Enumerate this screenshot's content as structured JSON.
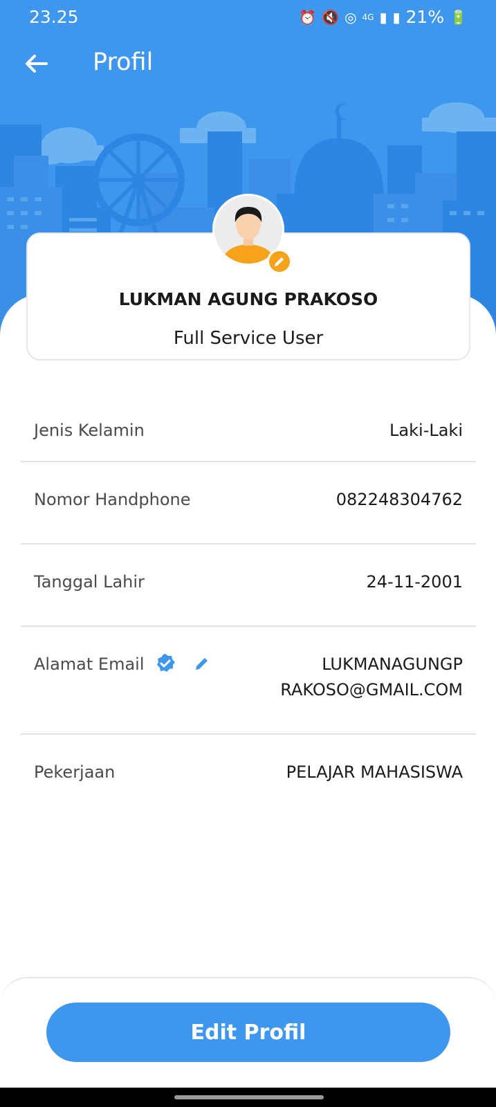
{
  "status_bar": {
    "time": "23.25",
    "network": "4G",
    "battery": "21%"
  },
  "header": {
    "title": "Profil",
    "back_icon": "arrow-left-icon"
  },
  "profile": {
    "name": "LUKMAN AGUNG PRAKOSO",
    "role": "Full Service User",
    "avatar_icon": "user-avatar",
    "edit_icon": "pencil-icon"
  },
  "fields": [
    {
      "label": "Jenis Kelamin",
      "value": "Laki-Laki"
    },
    {
      "label": "Nomor Handphone",
      "value": "082248304762"
    },
    {
      "label": "Tanggal Lahir",
      "value": "24-11-2001"
    },
    {
      "label": "Alamat Email",
      "value_line1": "LUKMANAGUNGP",
      "value_line2": "RAKOSO@GMAIL.COM"
    },
    {
      "label": "Pekerjaan",
      "value": "PELAJAR MAHASISWA"
    }
  ],
  "actions": {
    "edit_profile": "Edit Profil"
  },
  "colors": {
    "primary": "#3e97ec",
    "accent": "#f5a31a",
    "verified": "#3e97ec"
  }
}
